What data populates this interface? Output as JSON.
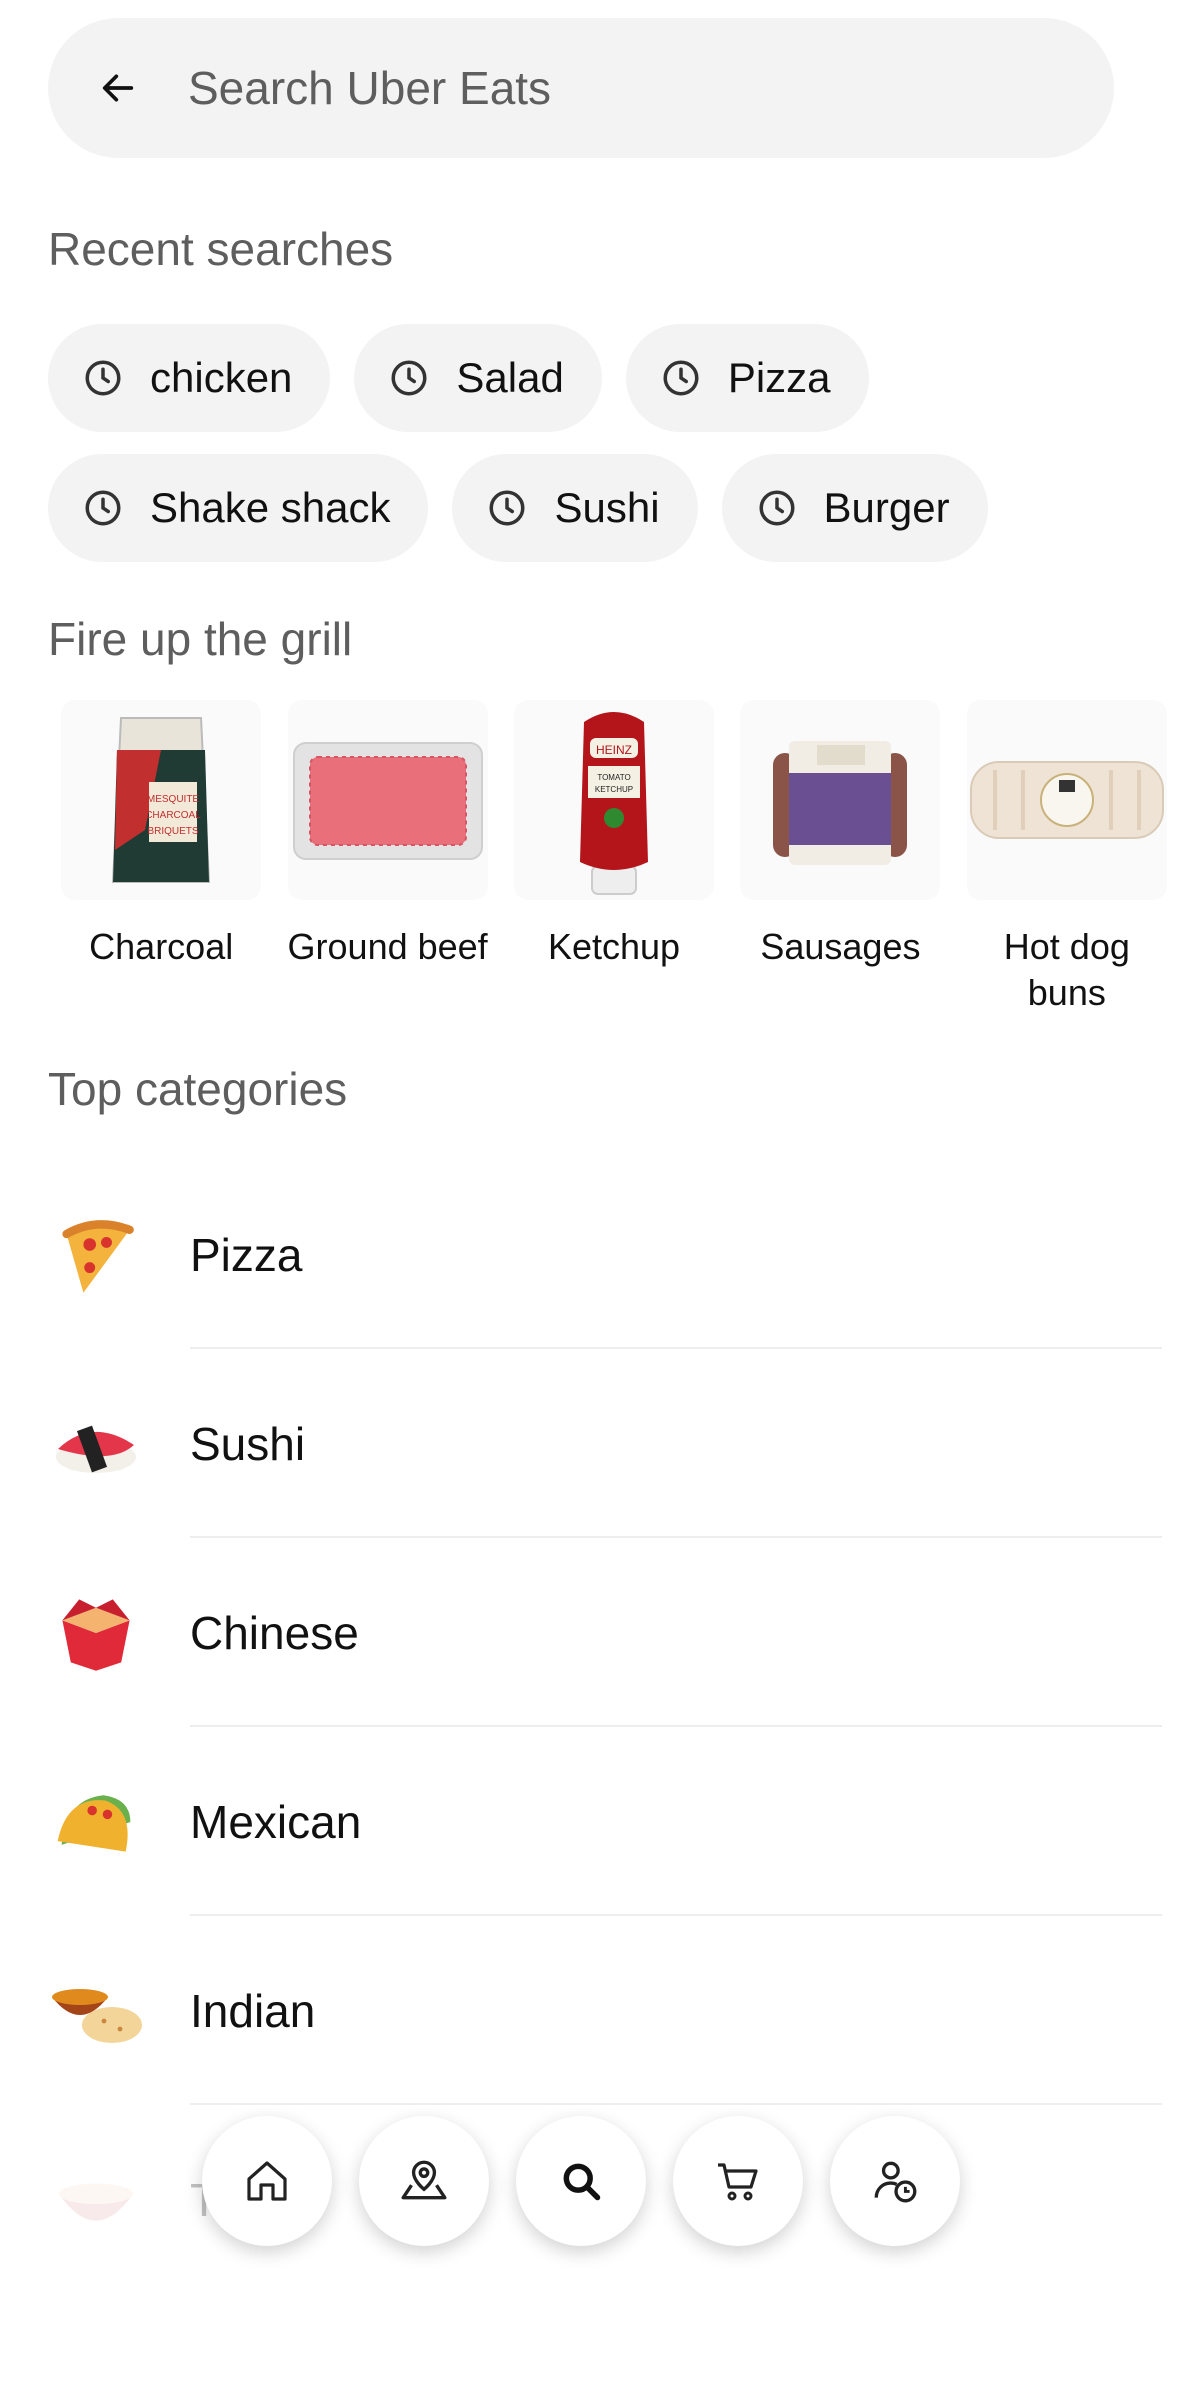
{
  "search": {
    "placeholder": "Search Uber Eats"
  },
  "recent": {
    "title": "Recent searches",
    "row1": [
      "chicken",
      "Salad",
      "Pizza"
    ],
    "row2": [
      "Shake shack",
      "Sushi",
      "Burger"
    ]
  },
  "grill": {
    "title": "Fire up the grill",
    "items": [
      {
        "label": "Charcoal",
        "icon": "charcoal-bag-image"
      },
      {
        "label": "Ground beef",
        "icon": "ground-beef-tray-image"
      },
      {
        "label": "Ketchup",
        "icon": "ketchup-bottle-image"
      },
      {
        "label": "Sausages",
        "icon": "sausages-pack-image"
      },
      {
        "label": "Hot dog buns",
        "icon": "hot-dog-buns-image"
      }
    ]
  },
  "categories": {
    "title": "Top categories",
    "items": [
      {
        "label": "Pizza",
        "icon": "pizza-icon"
      },
      {
        "label": "Sushi",
        "icon": "sushi-icon"
      },
      {
        "label": "Chinese",
        "icon": "takeout-box-icon"
      },
      {
        "label": "Mexican",
        "icon": "taco-icon"
      },
      {
        "label": "Indian",
        "icon": "curry-icon"
      },
      {
        "label": "T",
        "icon": "soup-bowl-icon"
      }
    ]
  },
  "nav": [
    "home-icon",
    "map-pin-icon",
    "search-icon",
    "cart-icon",
    "account-icon"
  ],
  "colors": {
    "chip_bg": "#f3f3f3",
    "muted_text": "#5e5e5e",
    "text": "#111111"
  }
}
